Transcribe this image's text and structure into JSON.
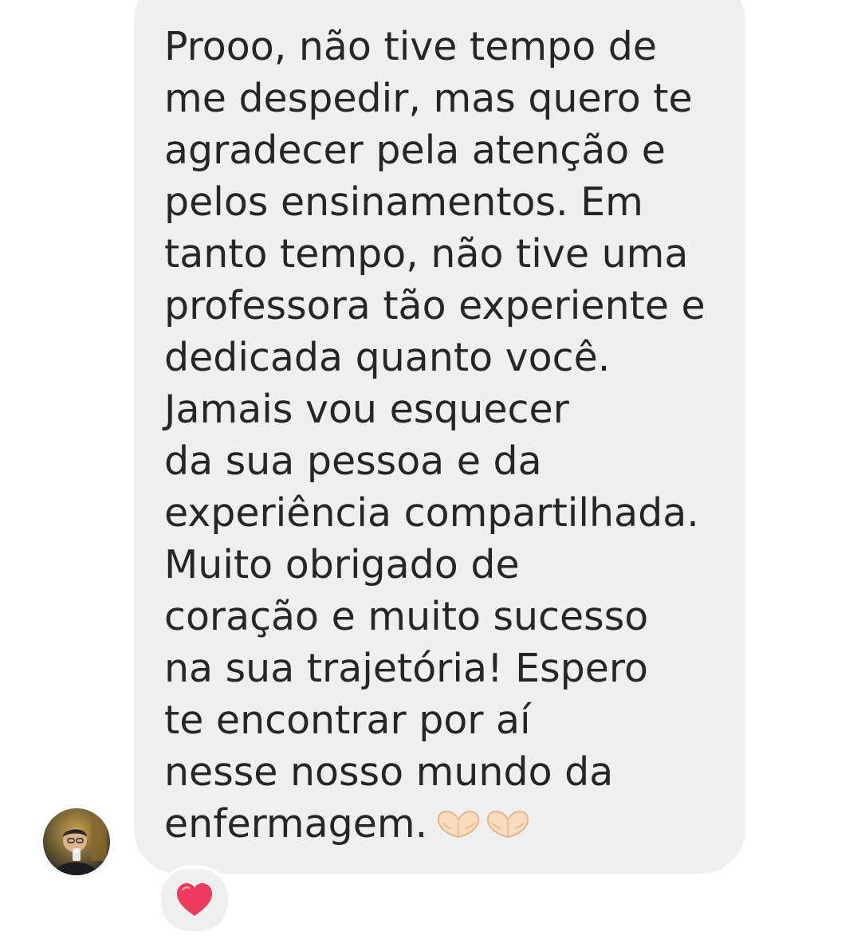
{
  "message": {
    "lines": [
      "Prooo, não tive tempo de",
      "me despedir, mas quero te",
      "agradecer pela atenção e",
      "pelos ensinamentos. Em",
      "tanto tempo, não tive uma",
      "professora tão experiente e",
      "dedicada quanto você.",
      "Jamais vou esquecer",
      "da sua pessoa e da",
      "experiência compartilhada.",
      "Muito obrigado de",
      "coração e muito sucesso",
      "na sua trajetória! Espero",
      "te encontrar por aí",
      "nesse nosso mundo da",
      "enfermagem."
    ],
    "emoji_icons": [
      "heart-hands-icon",
      "heart-hands-icon"
    ],
    "bubble_color": "#efefef",
    "text_color": "#262626"
  },
  "sender": {
    "avatar_icon": "profile-photo"
  },
  "reaction": {
    "icon": "red-heart-icon",
    "color": "#ee3b5d"
  }
}
